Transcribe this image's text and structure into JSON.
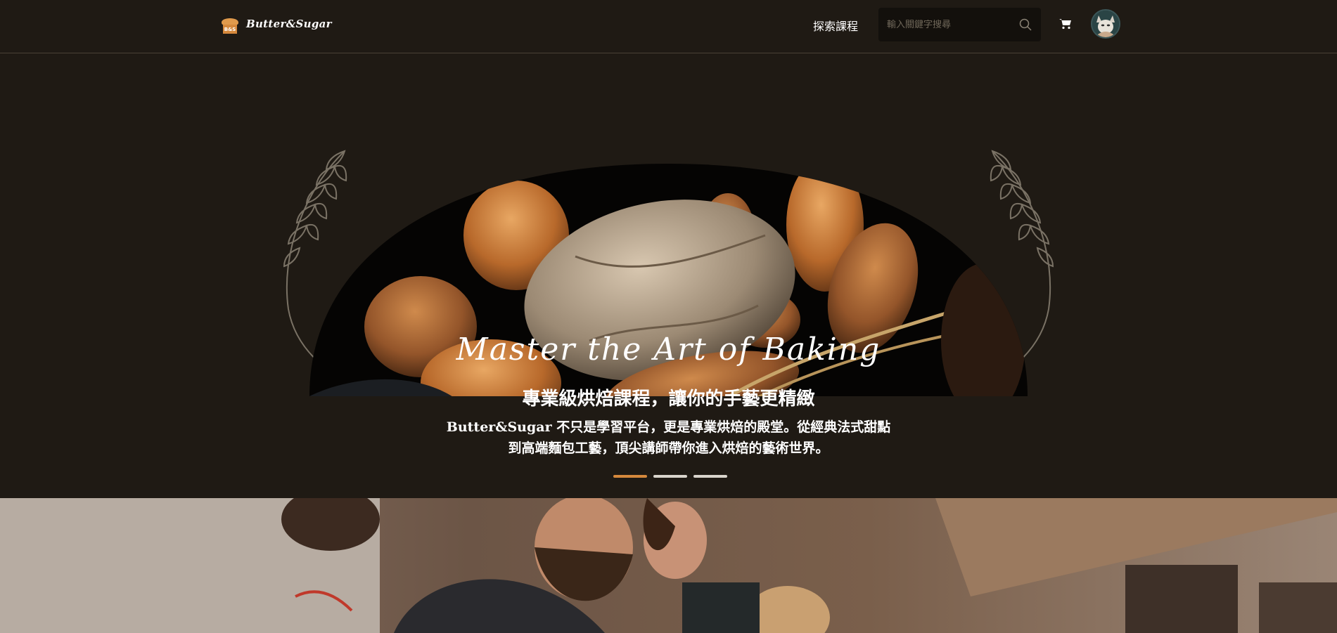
{
  "header": {
    "logo_badge": "B&S",
    "logo_text": "Butter&Sugar",
    "nav_explore": "探索課程",
    "search_placeholder": "輸入關鍵字搜尋"
  },
  "hero": {
    "title": "Master the Art of Baking",
    "subtitle": "專業級烘焙課程，讓你的手藝更精緻",
    "description_line1": "Butter&Sugar 不只是學習平台，更是專業烘焙的殿堂。從經典法式甜點",
    "description_line2": "到高端麵包工藝，頂尖講師帶你進入烘焙的藝術世界。",
    "slides": [
      {
        "active": true
      },
      {
        "active": false
      },
      {
        "active": false
      }
    ]
  },
  "colors": {
    "background": "#1f1a14",
    "accent": "#d5883c",
    "header_border": "#4a4236"
  },
  "icons": [
    "bread-logo-icon",
    "search-icon",
    "cart-icon",
    "avatar",
    "wheat-left-icon",
    "wheat-right-icon"
  ]
}
